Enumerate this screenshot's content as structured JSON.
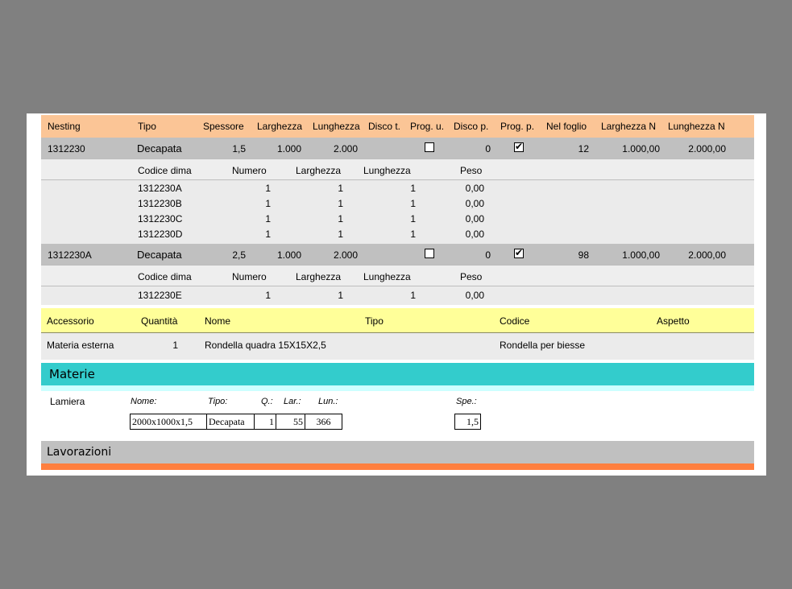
{
  "nesting_header": {
    "col_nesting": "Nesting",
    "col_tipo": "Tipo",
    "col_spessore": "Spessore",
    "col_larghezza": "Larghezza",
    "col_lunghezza": "Lunghezza",
    "col_disco_t": "Disco t.",
    "col_prog_u": "Prog. u.",
    "col_disco_p": "Disco p.",
    "col_prog_p": "Prog. p.",
    "col_nel_foglio": "Nel foglio",
    "col_larghezza_n": "Larghezza N",
    "col_lunghezza_n": "Lunghezza N"
  },
  "dima_header": {
    "codice": "Codice dima",
    "numero": "Numero",
    "larghezza": "Larghezza",
    "lunghezza": "Lunghezza",
    "peso": "Peso"
  },
  "nestings": [
    {
      "nesting": "1312230",
      "tipo": "Decapata",
      "spessore": "1,5",
      "larghezza": "1.000",
      "lunghezza": "2.000",
      "prog_u_checked": false,
      "disco_p": "0",
      "prog_p_checked": true,
      "nel_foglio": "12",
      "larghezza_n": "1.000,00",
      "lunghezza_n": "2.000,00",
      "dime": [
        {
          "codice": "1312230A",
          "numero": "1",
          "larghezza": "1",
          "lunghezza": "1",
          "peso": "0,00"
        },
        {
          "codice": "1312230B",
          "numero": "1",
          "larghezza": "1",
          "lunghezza": "1",
          "peso": "0,00"
        },
        {
          "codice": "1312230C",
          "numero": "1",
          "larghezza": "1",
          "lunghezza": "1",
          "peso": "0,00"
        },
        {
          "codice": "1312230D",
          "numero": "1",
          "larghezza": "1",
          "lunghezza": "1",
          "peso": "0,00"
        }
      ]
    },
    {
      "nesting": "1312230A",
      "tipo": "Decapata",
      "spessore": "2,5",
      "larghezza": "1.000",
      "lunghezza": "2.000",
      "prog_u_checked": false,
      "disco_p": "0",
      "prog_p_checked": true,
      "nel_foglio": "98",
      "larghezza_n": "1.000,00",
      "lunghezza_n": "2.000,00",
      "dime": [
        {
          "codice": "1312230E",
          "numero": "1",
          "larghezza": "1",
          "lunghezza": "1",
          "peso": "0,00"
        }
      ]
    }
  ],
  "accessori": {
    "header": {
      "accessorio": "Accessorio",
      "quantita": "Quantità",
      "nome": "Nome",
      "tipo": "Tipo",
      "codice": "Codice",
      "aspetto": "Aspetto"
    },
    "rows": [
      {
        "accessorio": "Materia esterna",
        "quantita": "1",
        "nome": "Rondella quadra 15X15X2,5",
        "tipo": "",
        "codice": "Rondella per biesse",
        "aspetto": ""
      }
    ]
  },
  "materie": {
    "title": "Materie",
    "label": "Lamiera",
    "labels": {
      "nome": "Nome:",
      "tipo": "Tipo:",
      "q": "Q.:",
      "lar": "Lar.:",
      "lun": "Lun.:",
      "spe": "Spe.:"
    },
    "values": {
      "nome": "2000x1000x1,5",
      "tipo": "Decapata",
      "q": "1",
      "lar": "55",
      "lun": "366",
      "spe": "1,5"
    }
  },
  "lavorazioni": {
    "title": "Lavorazioni"
  },
  "colors": {
    "header_bg": "#fbc596",
    "nesting_row_bg": "#c0c0c0",
    "dima_bg": "#ebebeb",
    "accessori_header_bg": "#ffff99",
    "materie_bg": "#33cccc",
    "lavorazioni_bg": "#c0c0c0",
    "lavorazioni_strip": "#ff7f3f",
    "outer_bg": "#808080"
  }
}
